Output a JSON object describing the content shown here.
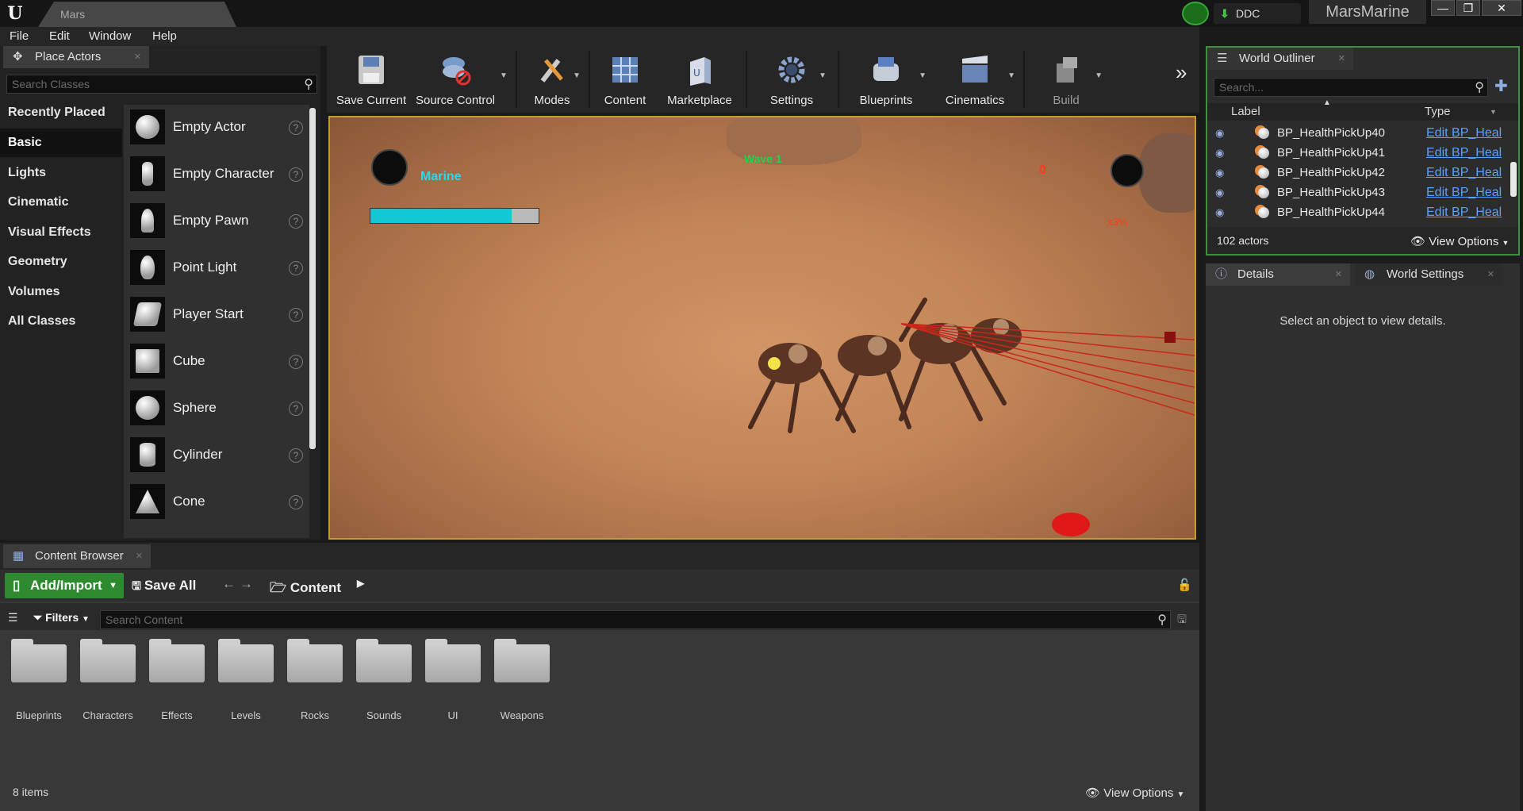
{
  "window": {
    "tab_title": "Mars",
    "ddc_label": "DDC",
    "project_name": "MarsMarine",
    "buttons": [
      "—",
      "❐",
      "✕"
    ]
  },
  "menu": [
    "File",
    "Edit",
    "Window",
    "Help"
  ],
  "place_actors": {
    "tab_label": "Place Actors",
    "search_placeholder": "Search Classes",
    "categories": [
      "Recently Placed",
      "Basic",
      "Lights",
      "Cinematic",
      "Visual Effects",
      "Geometry",
      "Volumes",
      "All Classes"
    ],
    "active_category": "Basic",
    "actors": [
      "Empty Actor",
      "Empty Character",
      "Empty Pawn",
      "Point Light",
      "Player Start",
      "Cube",
      "Sphere",
      "Cylinder",
      "Cone"
    ]
  },
  "toolbar": {
    "items": [
      "Save Current",
      "Source Control",
      "Modes",
      "Content",
      "Marketplace",
      "Settings",
      "Blueprints",
      "Cinematics",
      "Build"
    ],
    "more": "»"
  },
  "viewport": {
    "player_name": "Marine",
    "health_fraction": 0.84,
    "wave_label": "Wave 1",
    "score": "0",
    "enemy_label": "x3%"
  },
  "world_outliner": {
    "tab_label": "World Outliner",
    "search_placeholder": "Search...",
    "col_label": "Label",
    "col_type": "Type",
    "rows": [
      {
        "label": "BP_HealthPickUp40",
        "type": "Edit BP_Heal"
      },
      {
        "label": "BP_HealthPickUp41",
        "type": "Edit BP_Heal"
      },
      {
        "label": "BP_HealthPickUp42",
        "type": "Edit BP_Heal"
      },
      {
        "label": "BP_HealthPickUp43",
        "type": "Edit BP_Heal"
      },
      {
        "label": "BP_HealthPickUp44",
        "type": "Edit BP_Heal"
      }
    ],
    "actor_count": "102 actors",
    "view_options": "View Options"
  },
  "details": {
    "tab_details": "Details",
    "tab_world_settings": "World Settings",
    "empty_message": "Select an object to view details."
  },
  "content_browser": {
    "tab_label": "Content Browser",
    "add_import": "Add/Import",
    "save_all": "Save All",
    "path": "Content",
    "filters": "Filters",
    "search_placeholder": "Search Content",
    "folders": [
      "Blueprints",
      "Characters",
      "Effects",
      "Levels",
      "Rocks",
      "Sounds",
      "UI",
      "Weapons"
    ],
    "item_count": "8 items",
    "view_options": "View Options"
  }
}
